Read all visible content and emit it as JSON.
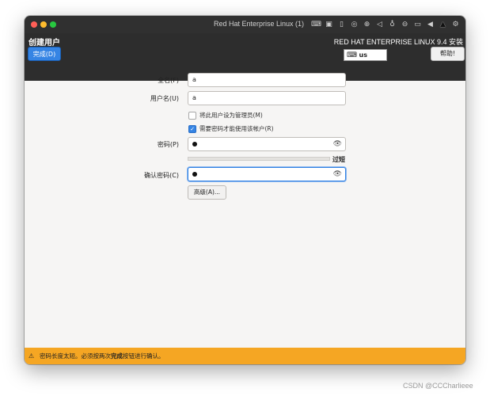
{
  "window": {
    "title": "Red Hat Enterprise Linux (1)"
  },
  "titlebar_icons": [
    "keyboard-icon",
    "cpu-icon",
    "usb-icon",
    "disc-icon",
    "globe-icon",
    "speaker-icon",
    "microphone-icon",
    "drive-icon",
    "camera-icon",
    "back-arrow-icon",
    "warning-icon",
    "settings-icon"
  ],
  "header": {
    "title": "创建用户",
    "done_label": "完成(D)",
    "product": "RED HAT ENTERPRISE LINUX 9.4 安装",
    "keyboard_layout": "us",
    "help_label": "帮助!"
  },
  "form": {
    "fullname": {
      "label": "全名(F)",
      "value": "a"
    },
    "username": {
      "label": "用户名(U)",
      "value": "a"
    },
    "admin_checkbox": {
      "label": "将此用户设为管理员(M)",
      "checked": false
    },
    "require_password_checkbox": {
      "label": "需要密码才能使用该帐户(R)",
      "checked": true
    },
    "password": {
      "label": "密码(P)"
    },
    "strength": {
      "label": "过短",
      "level": 0
    },
    "confirm": {
      "label": "确认密码(C)"
    },
    "advanced_label": "高级(A)..."
  },
  "warning": {
    "prefix": "密码长度太短。必须按两次",
    "bold": "完成",
    "suffix": "按钮进行确认。"
  },
  "watermark": "CSDN @CCCharlieee",
  "colors": {
    "accent": "#3584e4",
    "warning_bar": "#f5a623",
    "header_bg": "#2d2d2d"
  }
}
